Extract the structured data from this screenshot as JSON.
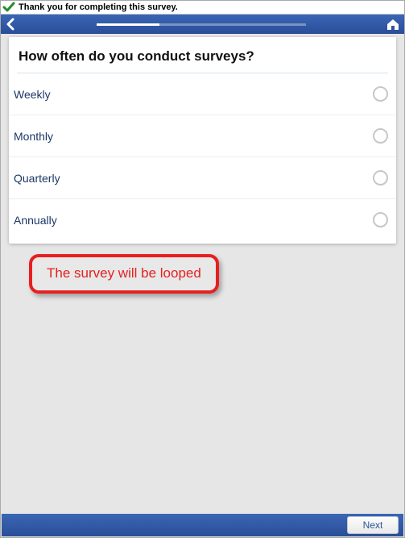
{
  "notification": {
    "text": "Thank you for completing this survey."
  },
  "topbar": {
    "progress_pct": 30
  },
  "question": {
    "text": "How often do you conduct surveys?",
    "options": [
      {
        "label": "Weekly"
      },
      {
        "label": "Monthly"
      },
      {
        "label": "Quarterly"
      },
      {
        "label": "Annually"
      }
    ]
  },
  "annotation": {
    "text": "The survey will be looped"
  },
  "footer": {
    "next_label": "Next"
  }
}
